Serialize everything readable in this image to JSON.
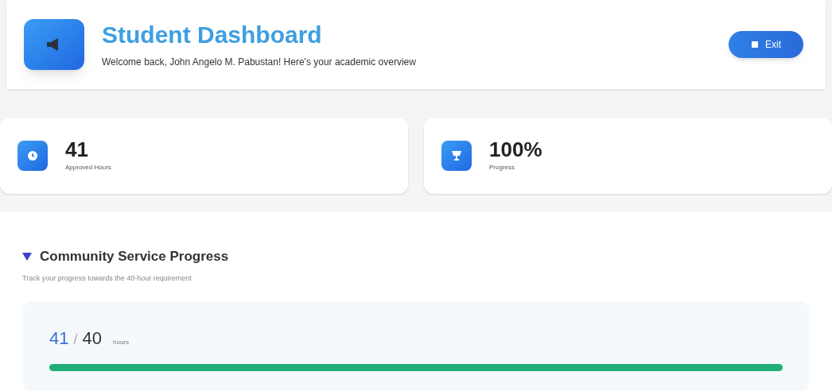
{
  "header": {
    "title": "Student Dashboard",
    "subtitle": "Welcome back, John Angelo M. Pabustan! Here's your academic overview",
    "button": "Exit"
  },
  "stats": [
    {
      "value": "41",
      "label": "Approved Hours",
      "kind": "clock"
    },
    {
      "value": "100%",
      "label": "Progress",
      "kind": "trophy"
    }
  ],
  "progress": {
    "title": "Community Service Progress",
    "subtitle": "Track your progress towards the 40-hour requirement",
    "current": "41",
    "separator": "/",
    "total": "40",
    "unit": "hours",
    "level": 1
  }
}
